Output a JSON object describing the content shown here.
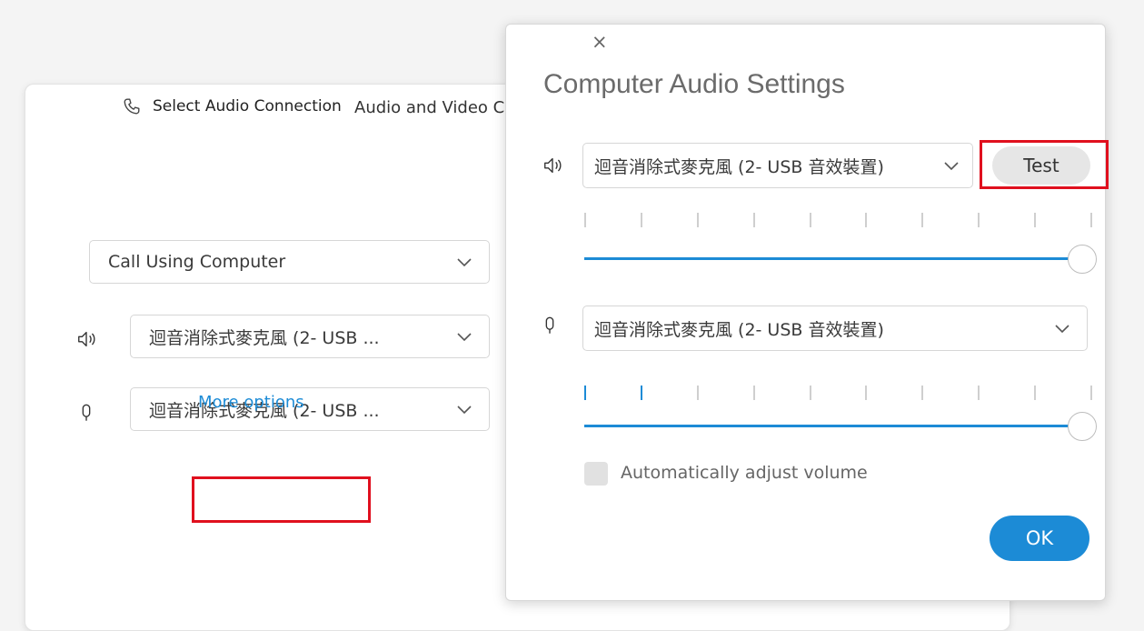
{
  "background_window": {
    "title": "Audio and Video Connection",
    "close_glyph": "×",
    "select_audio_label": "Select Audio Connection",
    "connection_dropdown": {
      "value": "Call Using Computer"
    },
    "speaker_dropdown": {
      "value": "迴音消除式麥克風 (2- USB ..."
    },
    "microphone_dropdown": {
      "value": "迴音消除式麥克風 (2- USB ..."
    },
    "more_options_link": "More options"
  },
  "dialog": {
    "title": "Computer Audio Settings",
    "close_glyph": "×",
    "speaker_select": {
      "value": "迴音消除式麥克風 (2- USB 音效裝置)"
    },
    "test_button": "Test",
    "speaker_volume": 1.0,
    "speaker_level_active_ticks": 0,
    "microphone_select": {
      "value": "迴音消除式麥克風 (2- USB 音效裝置)"
    },
    "microphone_volume": 1.0,
    "microphone_level_active_ticks": 2,
    "auto_adjust_label": "Automatically adjust volume",
    "auto_adjust_checked": false,
    "ok_button": "OK"
  },
  "colors": {
    "accent": "#1c8bd6",
    "highlight_box": "#e0101e",
    "tick_inactive": "#cfcfcf"
  },
  "icons": [
    "phone-icon",
    "speaker-icon",
    "microphone-icon",
    "chevron-down-icon",
    "close-icon"
  ]
}
